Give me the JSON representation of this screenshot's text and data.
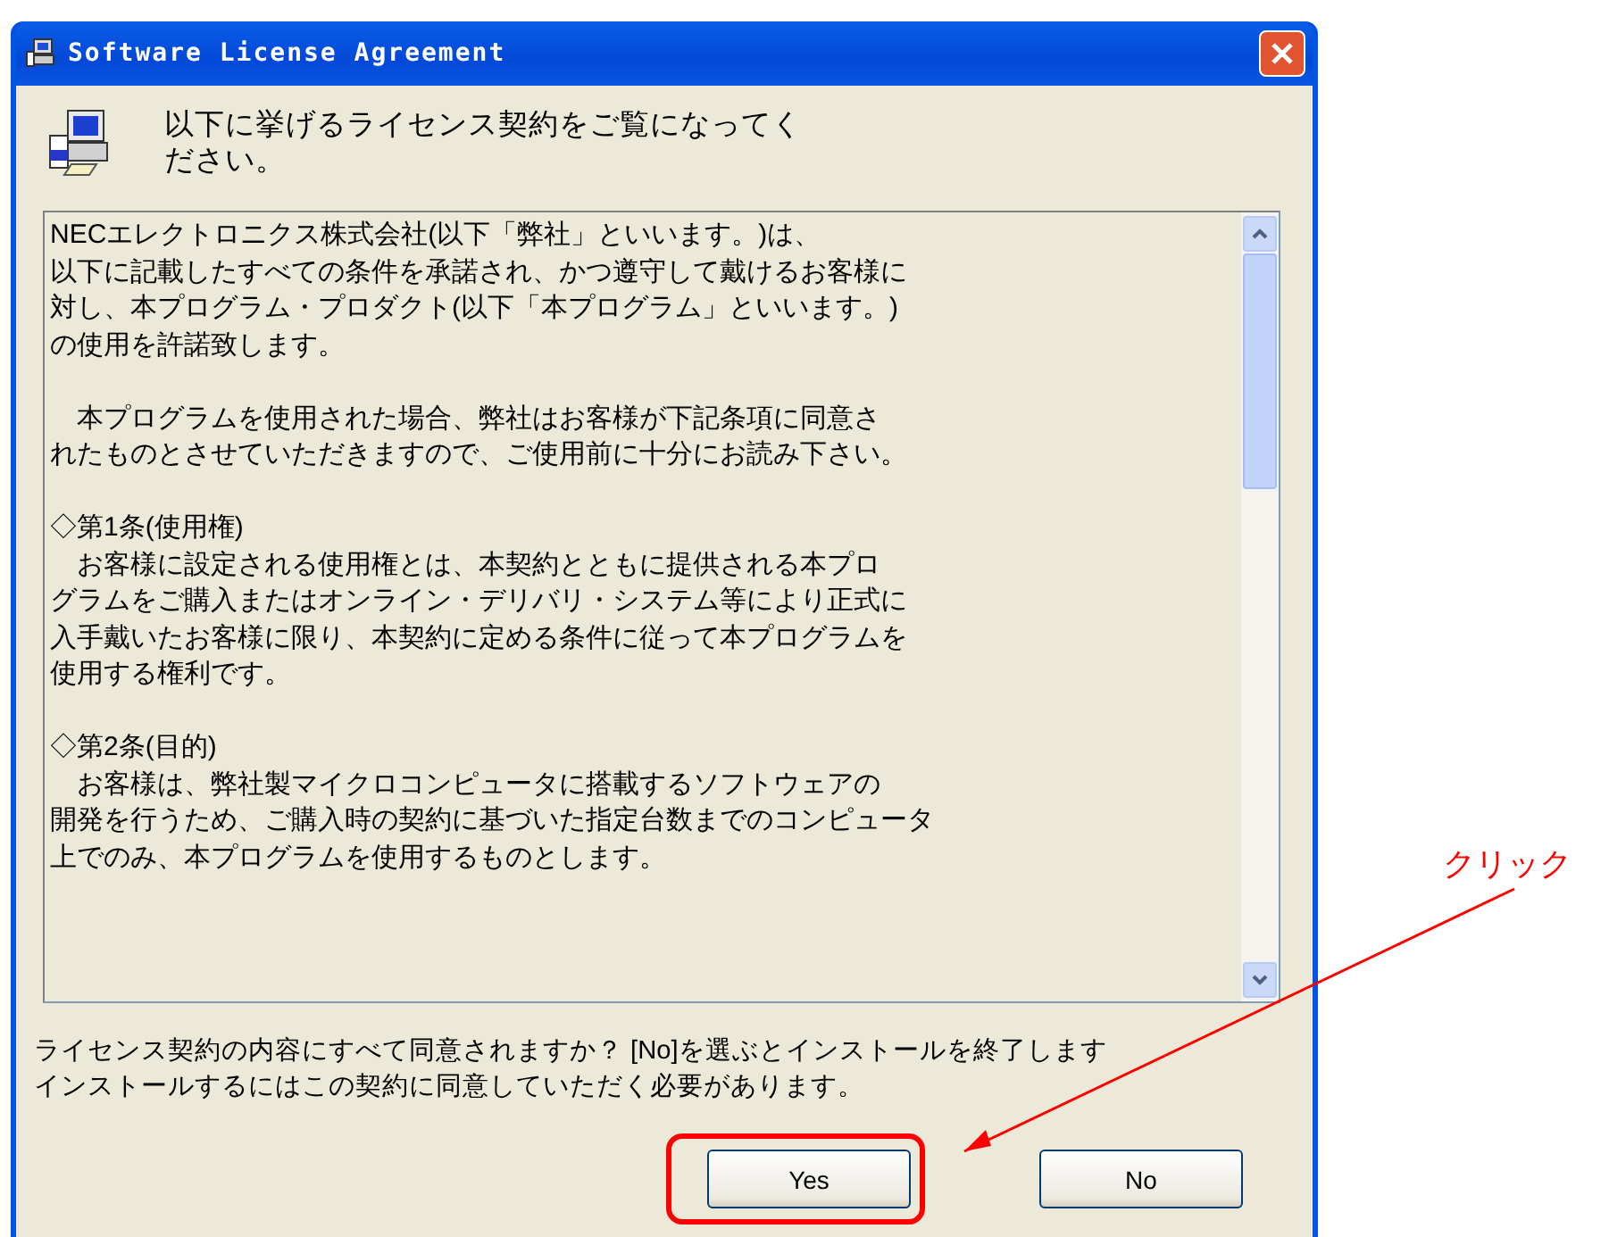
{
  "window": {
    "title": "Software License Agreement"
  },
  "header": {
    "text": "以下に挙げるライセンス契約をご覧になってください。"
  },
  "license": {
    "paragraphs": [
      {
        "lines": [
          "NECエレクトロニクス株式会社(以下「弊社」といいます。)は、",
          "以下に記載したすべての条件を承諾され、かつ遵守して戴けるお客様に",
          "対し、本プログラム・プロダクト(以下「本プログラム」といいます。)",
          "の使用を許諾致します。"
        ]
      },
      {
        "lines": [
          "　本プログラムを使用された場合、弊社はお客様が下記条項に同意さ",
          "れたものとさせていただきますので、ご使用前に十分にお読み下さい。"
        ]
      },
      {
        "lines": [
          "◇第1条(使用権)",
          "　お客様に設定される使用権とは、本契約とともに提供される本プロ",
          "グラムをご購入またはオンライン・デリバリ・システム等により正式に",
          "入手戴いたお客様に限り、本契約に定める条件に従って本プログラムを",
          "使用する権利です。"
        ]
      },
      {
        "lines": [
          "◇第2条(目的)",
          "　お客様は、弊社製マイクロコンピュータに搭載するソフトウェアの",
          "開発を行うため、ご購入時の契約に基づいた指定台数までのコンピュータ",
          "上でのみ、本プログラムを使用するものとします。"
        ]
      }
    ]
  },
  "prompt_lines": [
    "ライセンス契約の内容にすべて同意されますか？ [No]を選ぶとインストールを終了します",
    "インストールするにはこの契約に同意していただく必要があります。"
  ],
  "buttons": [
    {
      "label": "Yes",
      "highlighted": true
    },
    {
      "label": "No",
      "highlighted": false
    }
  ],
  "callout": {
    "text": "クリック"
  }
}
